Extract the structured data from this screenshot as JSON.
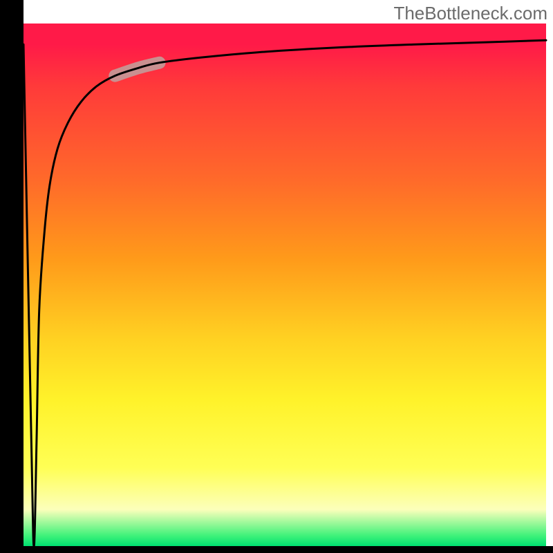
{
  "watermark": "TheBottleneck.com",
  "chart_data": {
    "type": "line",
    "title": "",
    "xlabel": "",
    "ylabel": "",
    "xlim": [
      0,
      100
    ],
    "ylim": [
      0,
      100
    ],
    "grid": false,
    "series": [
      {
        "name": "curve",
        "x": [
          0,
          1.5,
          2.0,
          2.5,
          3.0,
          4.0,
          5.0,
          6.5,
          8.5,
          11,
          14,
          17.5,
          22,
          26,
          34,
          45,
          60,
          75,
          88,
          100
        ],
        "values": [
          96,
          20,
          0,
          20,
          45,
          60,
          69,
          76,
          81,
          85,
          88,
          90,
          91.5,
          92.5,
          93.5,
          94.5,
          95.4,
          96,
          96.4,
          96.8
        ]
      }
    ],
    "highlight_segment": {
      "x_start": 17.5,
      "x_end": 26,
      "color": "#c99090",
      "thickness": 18
    },
    "colors": {
      "axis": "#000000",
      "curve": "#000000",
      "highlight": "#c99090",
      "gradient_top": "#ff1a48",
      "gradient_mid": "#fff22a",
      "gradient_bottom": "#00e070"
    }
  }
}
